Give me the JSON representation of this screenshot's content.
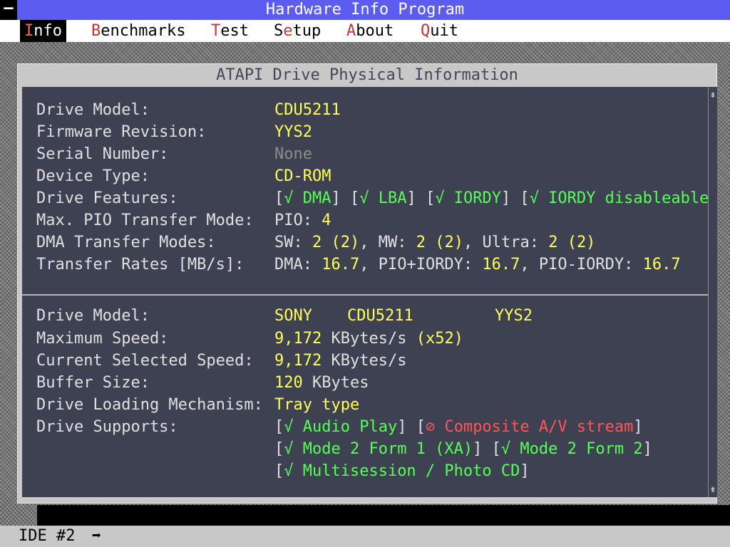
{
  "app": {
    "title": "Hardware Info Program",
    "system_menu_glyph": "—"
  },
  "menu": [
    {
      "hot": "I",
      "rest": "nfo",
      "active": true
    },
    {
      "hot": "B",
      "rest": "enchmarks",
      "active": false
    },
    {
      "hot": "T",
      "rest": "est",
      "active": false
    },
    {
      "pre": "S",
      "hot": "e",
      "rest": "tup",
      "active": false
    },
    {
      "hot": "A",
      "rest": "bout",
      "active": false
    },
    {
      "hot": "Q",
      "rest": "uit",
      "active": false
    }
  ],
  "window": {
    "title": "ATAPI Drive Physical Information"
  },
  "section1": {
    "drive_model_label": "Drive Model:",
    "drive_model": "CDU5211",
    "firmware_label": "Firmware Revision:",
    "firmware": "YYS2",
    "serial_label": "Serial Number:",
    "serial": "None",
    "device_type_label": "Device Type:",
    "device_type": "CD-ROM",
    "features_label": "Drive Features:",
    "features": [
      "√ DMA",
      "√ LBA",
      "√ IORDY",
      "√ IORDY disableable"
    ],
    "pio_label": "Max. PIO Transfer Mode:",
    "pio_prefix": "PIO:",
    "pio_value": "4",
    "dma_label": "DMA Transfer Modes:",
    "dma_sw_label": "SW:",
    "dma_sw": "2 (2)",
    "dma_mw_label": "MW:",
    "dma_mw": "2 (2)",
    "dma_ultra_label": "Ultra:",
    "dma_ultra": "2 (2)",
    "rates_label": "Transfer Rates [MB/s]:",
    "rate_dma_label": "DMA:",
    "rate_dma": "16.7",
    "rate_pio_iordy_label": "PIO+IORDY:",
    "rate_pio_iordy": "16.7",
    "rate_pio_noiordy_label": "PIO-IORDY:",
    "rate_pio_noiordy": "16.7"
  },
  "section2": {
    "drive_model_label": "Drive Model:",
    "vendor": "SONY",
    "model": "CDU5211",
    "revision": "YYS2",
    "max_speed_label": "Maximum Speed:",
    "max_speed_value": "9,172",
    "max_speed_unit": "KBytes/s",
    "max_speed_factor": "(x52)",
    "cur_speed_label": "Current Selected Speed:",
    "cur_speed_value": "9,172",
    "cur_speed_unit": "KBytes/s",
    "buffer_label": "Buffer Size:",
    "buffer_value": "120",
    "buffer_unit": "KBytes",
    "loading_label": "Drive Loading Mechanism:",
    "loading_value": "Tray type",
    "supports_label": "Drive Supports:",
    "support_audio": "√ Audio Play",
    "support_composite": "⊘ Composite A/V stream",
    "support_m2f1": "√ Mode 2 Form 1 (XA)",
    "support_m2f2": "√ Mode 2 Form 2",
    "support_multisession": "√ Multisession / Photo CD"
  },
  "statusbar": {
    "text": "IDE #2",
    "arrow": "➡"
  },
  "colors": {
    "title_bg": "#5c5cf0",
    "panel_bg": "#3e4152",
    "value_yellow": "#ffff55",
    "feature_green": "#55ff55",
    "unsupported_red": "#ff5555"
  }
}
